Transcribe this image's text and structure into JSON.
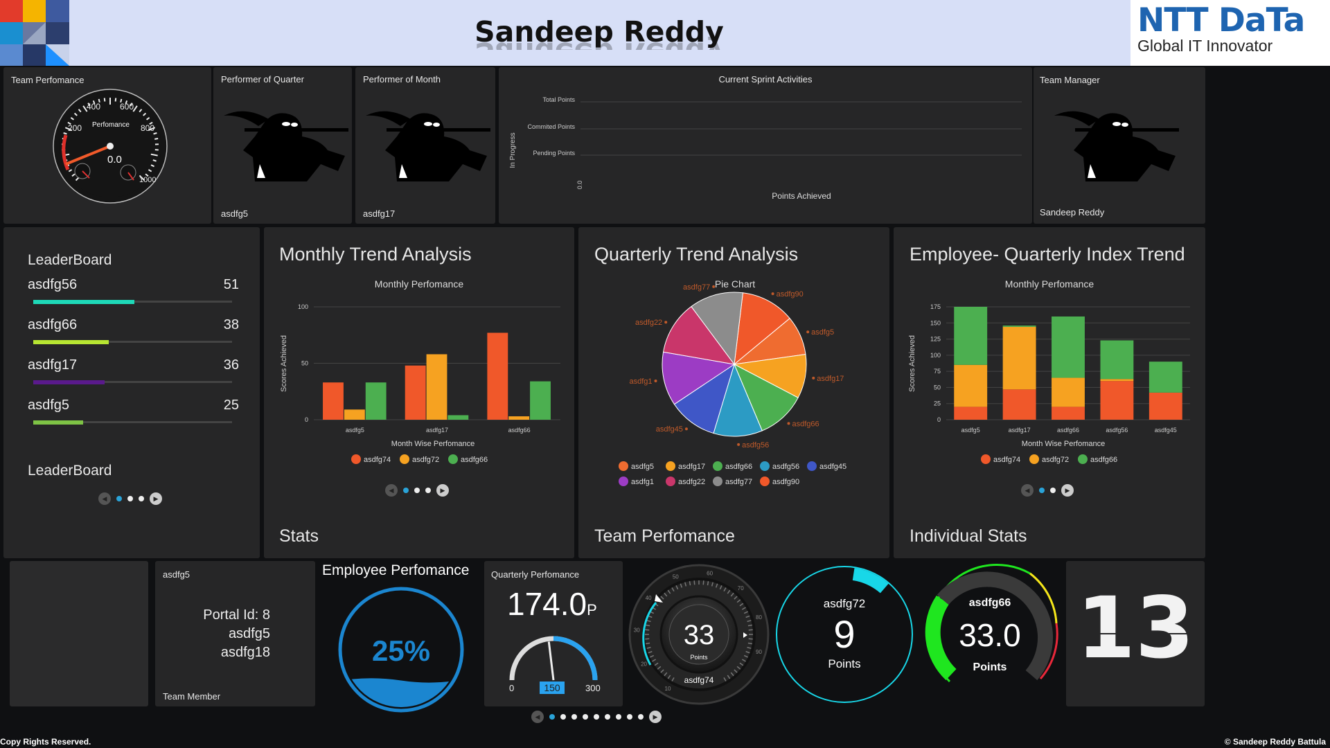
{
  "header": {
    "title": "Sandeep Reddy",
    "logo_brand": "NTT DaTa",
    "logo_tagline": "Global IT Innovator"
  },
  "row1": {
    "team_performance": {
      "title": "Team Perfomance",
      "gauge_label": "Perfomance",
      "gauge_value": "0.0",
      "ticks": [
        "200",
        "400",
        "600",
        "800",
        "1000"
      ]
    },
    "performer_quarter": {
      "title": "Performer of Quarter",
      "name": "asdfg5"
    },
    "performer_month": {
      "title": "Performer of Month",
      "name": "asdfg17"
    },
    "sprint": {
      "title": "Current Sprint Activities",
      "y_axis_label": "In Progress",
      "x_axis_label": "Points Achieved",
      "zero_label": "0.0",
      "categories": [
        "Total Points",
        "Commited Points",
        "Pending Points"
      ]
    },
    "team_manager": {
      "title": "Team Manager",
      "name": "Sandeep Reddy"
    }
  },
  "leaderboard": {
    "title": "LeaderBoard",
    "footer_title": "LeaderBoard",
    "entries": [
      {
        "name": "asdfg56",
        "value": "51",
        "color": "#1ed8b8",
        "fraction": 0.51
      },
      {
        "name": "asdfg66",
        "value": "38",
        "color": "#b7e532",
        "fraction": 0.38
      },
      {
        "name": "asdfg17",
        "value": "36",
        "color": "#5a1a8c",
        "fraction": 0.36
      },
      {
        "name": "asdfg5",
        "value": "25",
        "color": "#7ec345",
        "fraction": 0.25
      }
    ]
  },
  "monthly": {
    "title": "Monthly Trend Analysis",
    "footer_title": "Stats",
    "chart_data": {
      "type": "bar",
      "title": "Monthly Perfomance",
      "xlabel": "Month Wise Perfomance",
      "ylabel": "Scores Achieved",
      "ylim": [
        0,
        100
      ],
      "yticks": [
        "0",
        "50",
        "100"
      ],
      "categories": [
        "asdfg5",
        "asdfg17",
        "asdfg66"
      ],
      "series": [
        {
          "name": "asdfg74",
          "color": "#f0582a",
          "values": [
            33,
            48,
            77
          ]
        },
        {
          "name": "asdfg72",
          "color": "#f6a221",
          "values": [
            9,
            58,
            3
          ]
        },
        {
          "name": "asdfg66",
          "color": "#4caf50",
          "values": [
            33,
            4,
            34
          ]
        }
      ],
      "legend": "bottom"
    }
  },
  "quarterly": {
    "title": "Quarterly Trend Analysis",
    "footer_title": "Team Perfomance",
    "chart_data": {
      "type": "pie",
      "title": "Pie Chart",
      "slices": [
        {
          "name": "asdfg90",
          "color": "#f0582a",
          "value": 11
        },
        {
          "name": "asdfg5",
          "color": "#ef6c30",
          "value": 8
        },
        {
          "name": "asdfg17",
          "color": "#f6a221",
          "value": 9
        },
        {
          "name": "asdfg66",
          "color": "#4caf50",
          "value": 10
        },
        {
          "name": "asdfg56",
          "color": "#2c9bc4",
          "value": 10
        },
        {
          "name": "asdfg45",
          "color": "#3f57c7",
          "value": 10
        },
        {
          "name": "asdfg1",
          "color": "#9c3cc4",
          "value": 11
        },
        {
          "name": "asdfg22",
          "color": "#c9366a",
          "value": 11
        },
        {
          "name": "asdfg77",
          "color": "#8c8c8c",
          "value": 11
        }
      ],
      "legend_order": [
        "asdfg5",
        "asdfg17",
        "asdfg66",
        "asdfg56",
        "asdfg45",
        "asdfg1",
        "asdfg22",
        "asdfg77",
        "asdfg90"
      ],
      "legend": "bottom"
    }
  },
  "employee_quarterly": {
    "title": "Employee- Quarterly Index Trend",
    "footer_title": "Individual Stats",
    "chart_data": {
      "type": "bar",
      "stacked": true,
      "title": "Monthly Perfomance",
      "xlabel": "Month Wise Perfomance",
      "ylabel": "Scores Achieved",
      "ylim": [
        0,
        175
      ],
      "yticks": [
        "0",
        "25",
        "50",
        "75",
        "100",
        "125",
        "150",
        "175"
      ],
      "categories": [
        "asdfg5",
        "asdfg17",
        "asdfg66",
        "asdfg56",
        "asdfg45"
      ],
      "series": [
        {
          "name": "asdfg74",
          "color": "#f0582a",
          "values": [
            20,
            47,
            20,
            60,
            42
          ]
        },
        {
          "name": "asdfg72",
          "color": "#f6a221",
          "values": [
            65,
            97,
            45,
            3,
            0
          ]
        },
        {
          "name": "asdfg66",
          "color": "#4caf50",
          "values": [
            90,
            2,
            95,
            60,
            48
          ]
        }
      ],
      "legend": "bottom"
    }
  },
  "bottom": {
    "member": {
      "name": "asdfg5",
      "lines": [
        "Portal Id: 8",
        "asdfg5",
        "asdfg18"
      ],
      "role": "Team Member"
    },
    "employee_perf": {
      "title": "Employee Perfomance",
      "percent": "25%",
      "fraction": 0.25
    },
    "quarterly_perf": {
      "title": "Quarterly Perfomance",
      "value": "174.0",
      "unit": "P",
      "min": "0",
      "max": "300",
      "needle": "150",
      "needle_value": 150,
      "max_value": 300
    },
    "dial": {
      "value": "33",
      "unit": "Points",
      "name": "asdfg74",
      "ticks": [
        "10",
        "20",
        "30",
        "40",
        "50",
        "60",
        "70",
        "80",
        "90"
      ],
      "fraction": 0.33
    },
    "ring_cyan": {
      "name": "asdfg72",
      "value": "9",
      "unit": "Points",
      "fraction": 0.09
    },
    "ring_color": {
      "name": "asdfg66",
      "value": "33.0",
      "unit": "Points"
    },
    "flip": {
      "value": "13"
    }
  },
  "footer": {
    "left": "Copy Rights Reserved.",
    "right": "© Sandeep Reddy Battula"
  }
}
